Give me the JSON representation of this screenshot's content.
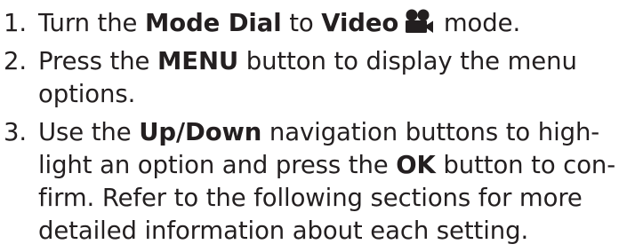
{
  "steps": [
    {
      "number": "1.",
      "parts": {
        "t1": "Turn the ",
        "b1": "Mode Dial",
        "t2": " to ",
        "b2": "Video",
        "t3": " mode."
      },
      "icon": "video-camera-icon"
    },
    {
      "number": "2.",
      "parts": {
        "t1": "Press the ",
        "b1": "MENU",
        "t2": " button to display the menu",
        "t3": "options."
      }
    },
    {
      "number": "3.",
      "parts": {
        "t1": "Use the ",
        "b1": "Up/Down",
        "t2": " navigation buttons to high-",
        "t3": "light an option and press the ",
        "b2": "OK",
        "t4": " button to con-",
        "t5": "firm. Refer to the following sections for more",
        "t6": "detailed information about each setting."
      }
    }
  ],
  "colors": {
    "text": "#231f20"
  }
}
